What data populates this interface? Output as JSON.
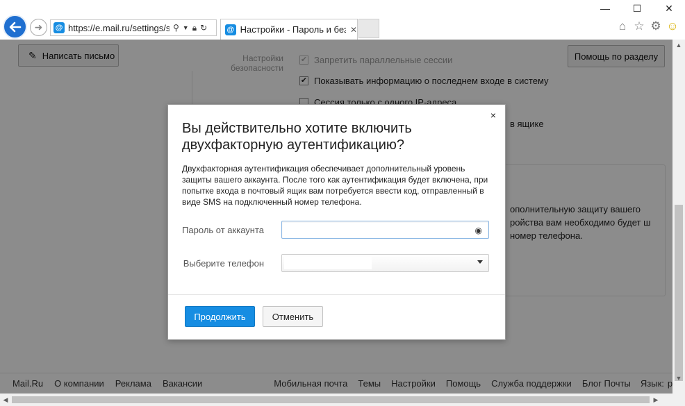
{
  "browser": {
    "url": "https://e.mail.ru/settings/se",
    "tab_title": "Настройки - Пароль и без",
    "favicon_glyph": "@",
    "window_controls": {
      "minimize": "—",
      "maximize": "☐",
      "close": "✕"
    },
    "toolbar_icons": [
      "home-icon",
      "star-icon",
      "gear-icon",
      "smiley-icon"
    ]
  },
  "page": {
    "compose_label": "Написать письмо",
    "help_label": "Помощь по разделу",
    "side_section": "Настройки безопасности",
    "options": [
      {
        "label": "Запретить параллельные сессии",
        "checked": true,
        "disabled": true
      },
      {
        "label": "Показывать информацию о последнем входе в систему",
        "checked": true,
        "disabled": false
      },
      {
        "label": "Сессия только с одного IP-адреса",
        "checked": false,
        "disabled": false
      }
    ],
    "partial_text_1": "в ящике",
    "partial_text_2": "ополнительную защиту вашего ройства вам необходимо будет ш номер телефона."
  },
  "footer": {
    "left": [
      "Mail.Ru",
      "О компании",
      "Реклама",
      "Вакансии"
    ],
    "right": [
      "Мобильная почта",
      "Темы",
      "Настройки",
      "Помощь",
      "Служба поддержки",
      "Блог Почты"
    ],
    "lang_label": "Язык:",
    "lang_value": "русский"
  },
  "dialog": {
    "title": "Вы действительно хотите включить двухфакторную аутентификацию?",
    "description": "Двухфакторная аутентификация обеспечивает дополнительный уровень защиты вашего аккаунта. После того как аутентификация будет включена, при попытке входа в почтовый ящик вам потребуется ввести код, отправленный в виде SMS на подключенный номер телефона.",
    "password_label": "Пароль от аккаунта",
    "password_value": "",
    "phone_label": "Выберите телефон",
    "continue_label": "Продолжить",
    "cancel_label": "Отменить",
    "close_glyph": "×"
  },
  "colors": {
    "accent": "#168de2",
    "back_button": "#1f6fd0",
    "overlay": "rgba(0,0,0,0.45)"
  }
}
